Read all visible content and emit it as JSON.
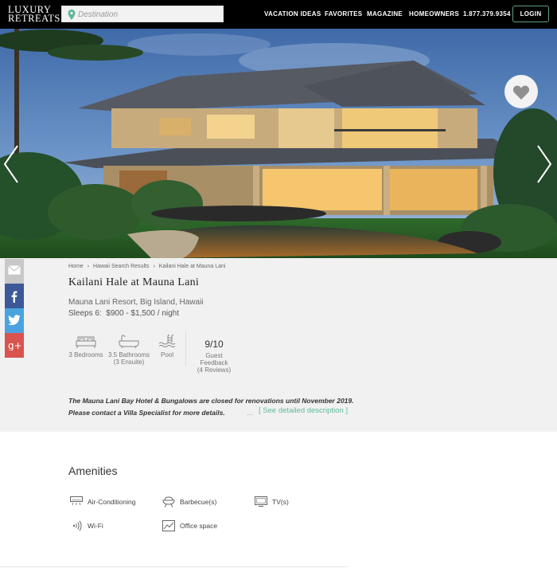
{
  "header": {
    "logo_line1": "LUXURY",
    "logo_line2": "RETREATS",
    "search_placeholder": "Destination",
    "nav": [
      "VACATION IDEAS",
      "FAVORITES",
      "MAGAZINE",
      "HOMEOWNERS",
      "1.877.379.9354"
    ],
    "login": "LOGIN"
  },
  "breadcrumb": [
    "Home",
    "Hawaii Search Results",
    "Kailani Hale at Mauna Lani"
  ],
  "property": {
    "title": "Kailani Hale at Mauna Lani",
    "location": "Mauna Lani Resort, Big Island, Hawaii",
    "sleeps_label": "Sleeps 6:",
    "price": "$900 - $1,500 / night"
  },
  "features": {
    "bedrooms": "3 Bedrooms",
    "bathrooms": "3.5 Bathrooms",
    "bathrooms_note": "(3 Ensuite)",
    "pool": "Pool",
    "score": "9/10",
    "feedback_label": "Guest Feedback",
    "reviews": "(4 Reviews)"
  },
  "notice": {
    "line1": "The Mauna Lani Bay Hotel & Bungalows are closed for renovations until November 2019.",
    "line2": "Please contact a Villa Specialist for more details.",
    "ellipsis": "...",
    "link": "[ See detailed description ]"
  },
  "amenities": {
    "title": "Amenities",
    "items": [
      "Air-Conditioning",
      "Barbecue(s)",
      "TV(s)",
      "Wi-Fi",
      "Office space"
    ]
  },
  "colors": {
    "accent": "#5fb89e",
    "header_bg": "#000000",
    "email": "#c8c8c8",
    "facebook": "#3b5998",
    "twitter": "#4aa3df",
    "googleplus": "#d9534f"
  }
}
